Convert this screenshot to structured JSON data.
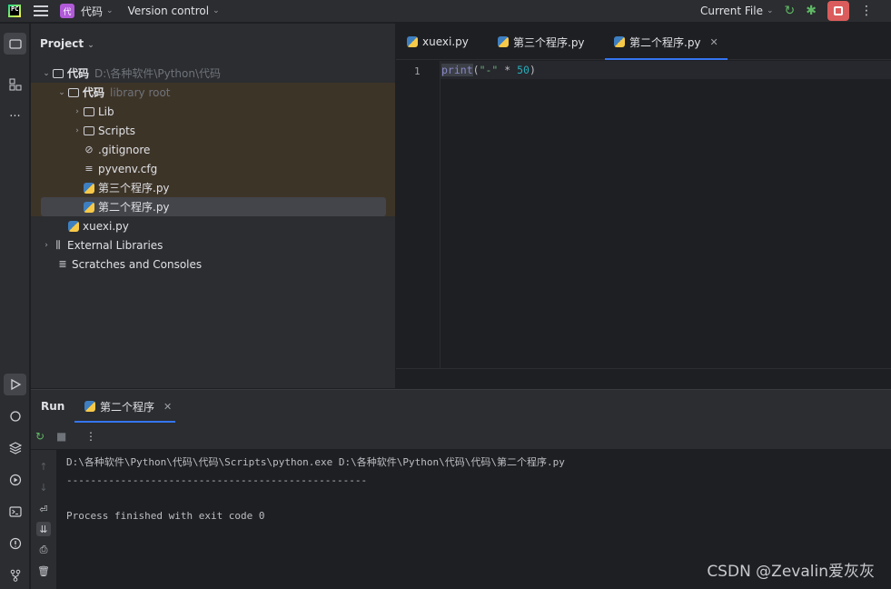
{
  "titlebar": {
    "logo_text": "PC",
    "project_badge": "代",
    "project_name": "代码",
    "version_control": "Version control",
    "run_config": "Current File"
  },
  "project_panel": {
    "title": "Project",
    "tree": [
      {
        "label": "代码",
        "hint": "D:\\各种软件\\Python\\代码",
        "kind": "folder",
        "expanded": true
      },
      {
        "label": "代码",
        "hint": "library root",
        "kind": "folder",
        "expanded": true
      },
      {
        "label": "Lib",
        "kind": "folder",
        "expanded": false
      },
      {
        "label": "Scripts",
        "kind": "folder",
        "expanded": false
      },
      {
        "label": ".gitignore",
        "kind": "ignore"
      },
      {
        "label": "pyvenv.cfg",
        "kind": "cfg"
      },
      {
        "label": "第三个程序.py",
        "kind": "py"
      },
      {
        "label": "第二个程序.py",
        "kind": "py",
        "selected": true
      },
      {
        "label": "xuexi.py",
        "kind": "py"
      },
      {
        "label": "External Libraries",
        "kind": "lib",
        "expanded": false
      },
      {
        "label": "Scratches and Consoles",
        "kind": "scratch"
      }
    ]
  },
  "editor": {
    "tabs": [
      {
        "label": "xuexi.py"
      },
      {
        "label": "第三个程序.py"
      },
      {
        "label": "第二个程序.py",
        "active": true
      }
    ],
    "line_number": "1",
    "code": {
      "fn": "print",
      "open": "(",
      "str": "\"-\"",
      "op": " * ",
      "num": "50",
      "close": ")"
    }
  },
  "run": {
    "title": "Run",
    "tab_label": "第二个程序",
    "console_lines": [
      "D:\\各种软件\\Python\\代码\\代码\\Scripts\\python.exe D:\\各种软件\\Python\\代码\\代码\\第二个程序.py",
      "--------------------------------------------------",
      "",
      "Process finished with exit code 0"
    ]
  },
  "watermark": "CSDN @Zevalin爱灰灰",
  "colors": {
    "accent": "#3574f0",
    "stop": "#db5c5c",
    "badge": "#b15ad8",
    "run_green": "#5fb865"
  }
}
